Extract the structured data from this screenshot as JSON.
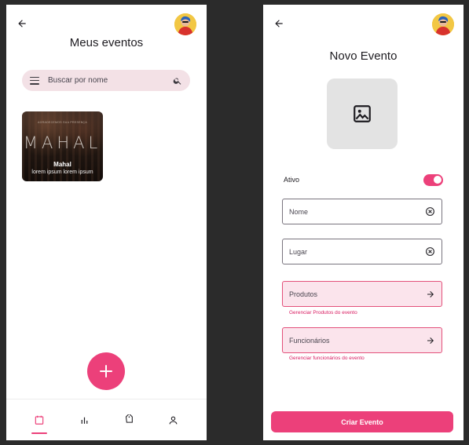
{
  "left_screen": {
    "title": "Meus eventos",
    "search": {
      "placeholder": "Buscar por nome"
    },
    "events": [
      {
        "logo_text": "MAHAL",
        "caption": "AGRADECEMOS SUA PRESENÇA",
        "name": "Mahal",
        "description": "lorem ipsum lorem ipsum"
      }
    ],
    "fab_icon": "plus-icon",
    "bottom_nav": [
      {
        "icon": "calendar-icon",
        "active": true
      },
      {
        "icon": "bar-chart-icon",
        "active": false
      },
      {
        "icon": "tag-icon",
        "active": false
      },
      {
        "icon": "person-icon",
        "active": false
      }
    ]
  },
  "right_screen": {
    "title": "Novo Evento",
    "image_placeholder_icon": "image-icon",
    "active_toggle": {
      "label": "Ativo",
      "on": true
    },
    "fields": [
      {
        "placeholder": "Nome",
        "value": ""
      },
      {
        "placeholder": "Lugar",
        "value": ""
      }
    ],
    "links": [
      {
        "label": "Produtos",
        "helper": "Gerenciar Produtos do evento"
      },
      {
        "label": "Funcionários",
        "helper": "Gerenciar funcionários do evento"
      }
    ],
    "submit_label": "Criar Evento"
  },
  "colors": {
    "accent": "#ec407a",
    "search_bg": "#f3e1e6",
    "link_bg": "#fbe4ec",
    "helper_text": "#d81b60",
    "placeholder_bg": "#e3e3e3"
  }
}
